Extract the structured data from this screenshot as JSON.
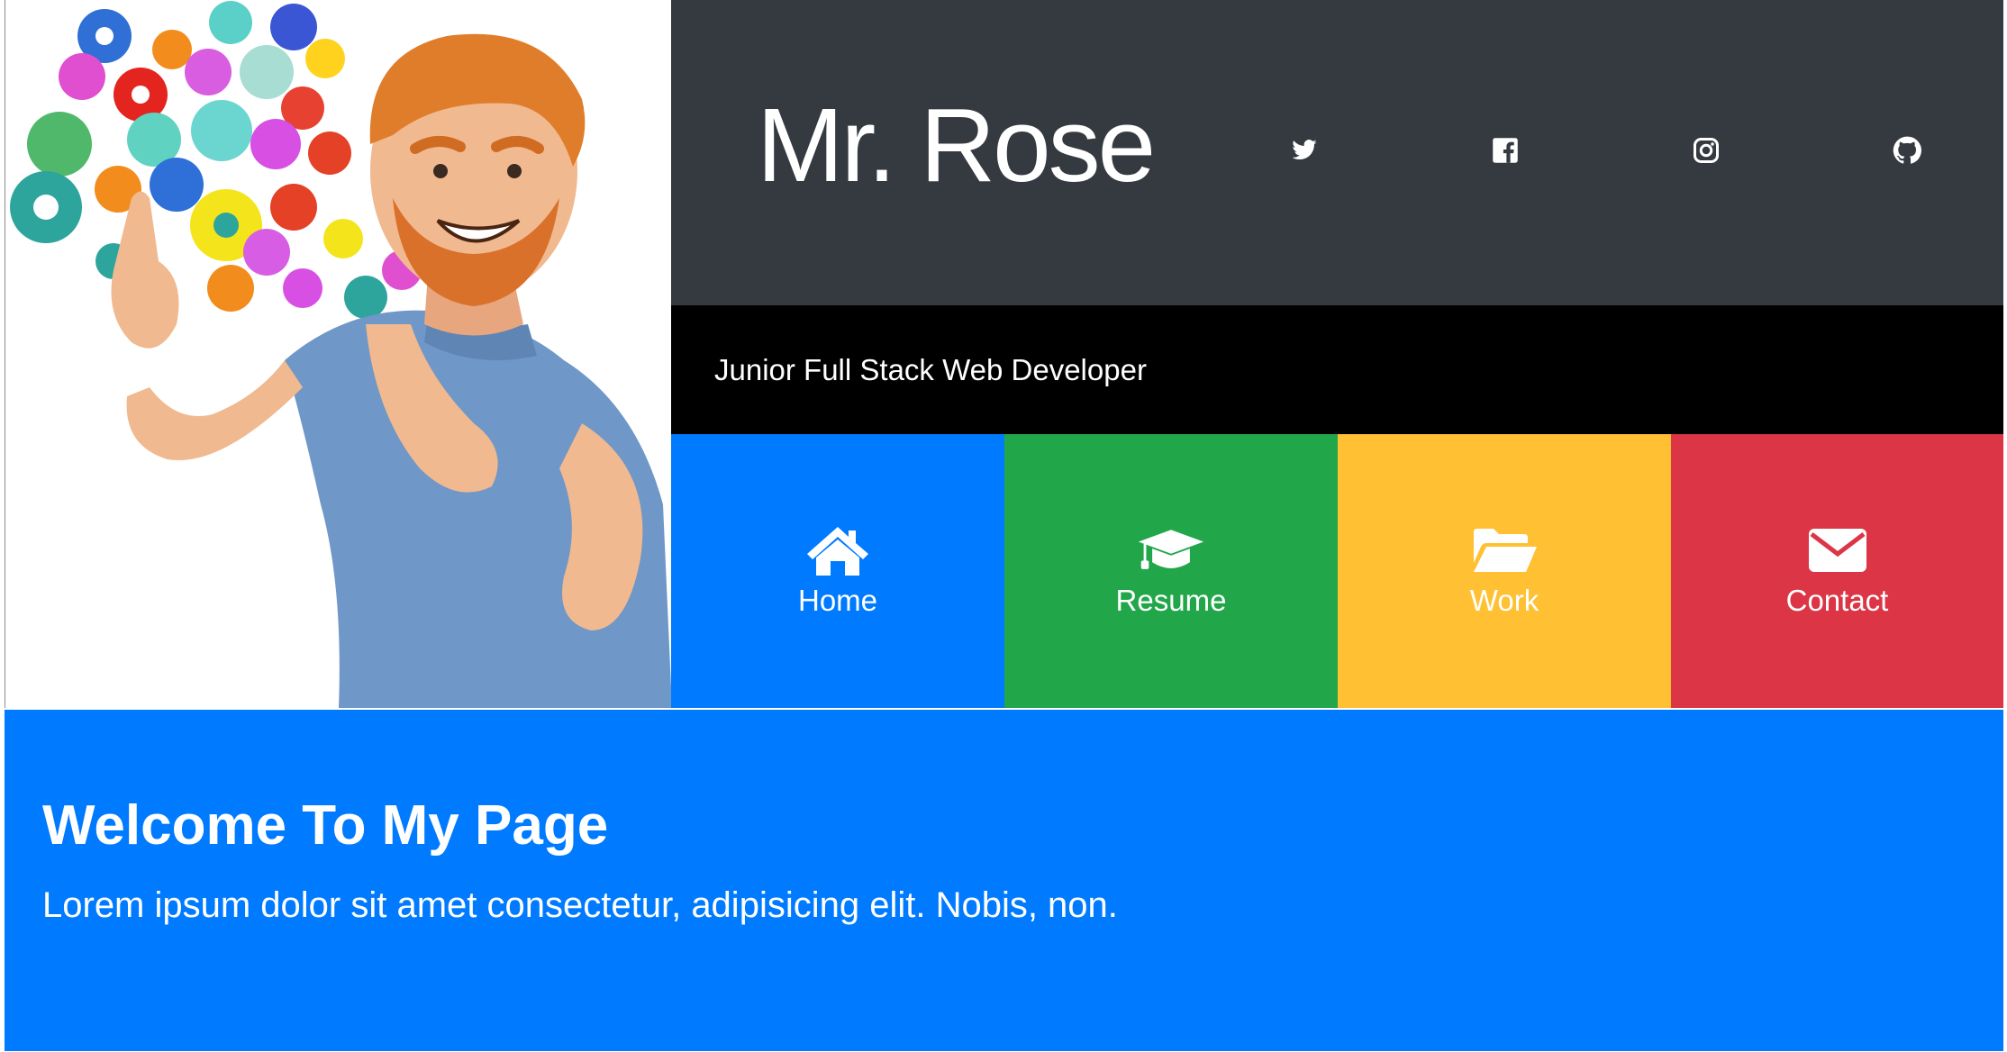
{
  "header": {
    "name": "Mr. Rose",
    "tagline": "Junior Full Stack Web Developer",
    "social": [
      {
        "icon": "twitter-icon"
      },
      {
        "icon": "facebook-icon"
      },
      {
        "icon": "instagram-icon"
      },
      {
        "icon": "github-icon"
      }
    ]
  },
  "portrait": {
    "icon": "cartoon-man-with-gears-illustration"
  },
  "nav": {
    "tiles": [
      {
        "label": "Home",
        "icon": "home-icon",
        "color": "#007bff"
      },
      {
        "label": "Resume",
        "icon": "graduation-cap-icon",
        "color": "#21a74a"
      },
      {
        "label": "Work",
        "icon": "folder-open-icon",
        "color": "#ffc133"
      },
      {
        "label": "Contact",
        "icon": "envelope-icon",
        "color": "#dc3545"
      }
    ]
  },
  "jumbotron": {
    "title": "Welcome To My Page",
    "text": "Lorem ipsum dolor sit amet consectetur, adipisicing elit. Nobis, non.",
    "color": "#007bff"
  },
  "theme": {
    "header_dark": "#343a40",
    "tagline_bg": "#000000"
  }
}
